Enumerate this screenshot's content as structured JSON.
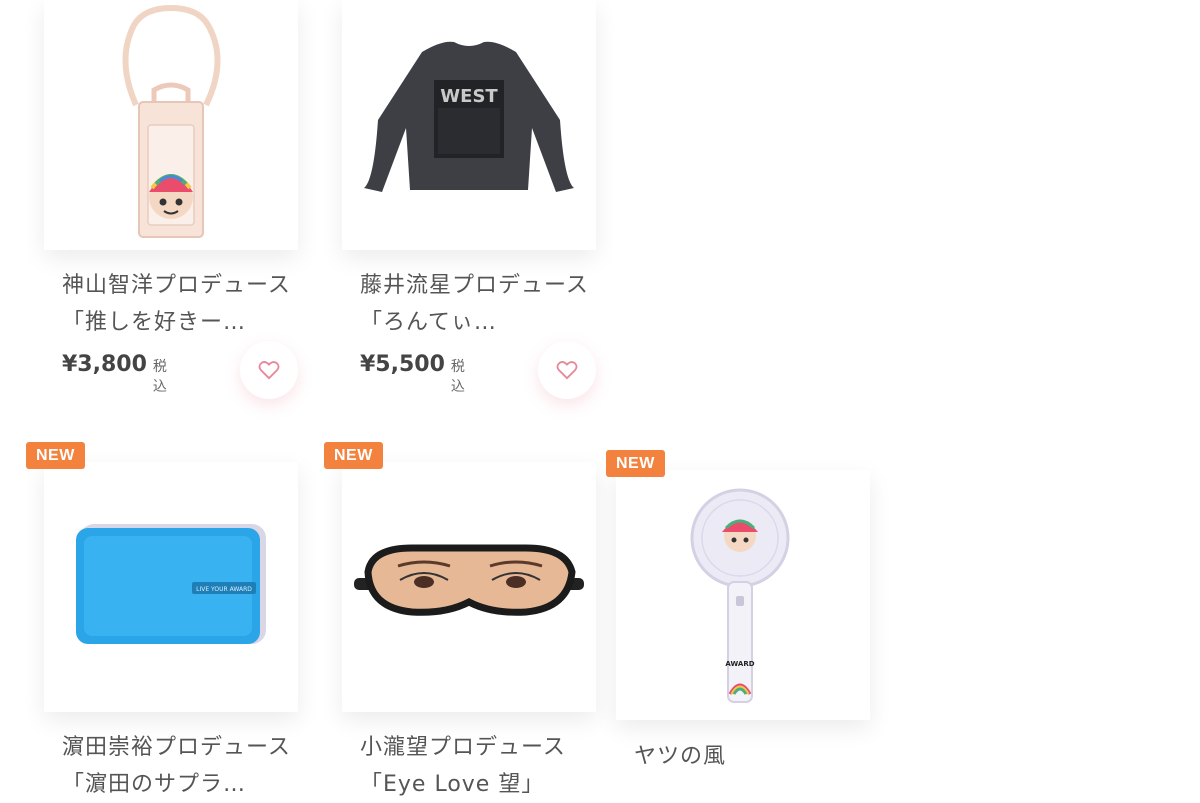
{
  "products": [
    {
      "title": "神山智洋プロデュース「推しを好きー…",
      "price": "¥3,800",
      "tax_label": "税込",
      "image_icon": "tote-bag-icon"
    },
    {
      "title": "藤井流星プロデュース「ろんてぃ…",
      "price": "¥5,500",
      "tax_label": "税込",
      "image_icon": "long-sleeve-shirt-icon",
      "shirt_print": "WEST"
    },
    {
      "badge": "NEW",
      "title": "濵田崇裕プロデュース「濵田のサプラ…",
      "image_icon": "blue-pouch-icon",
      "pouch_tag": "LIVE YOUR AWARD"
    },
    {
      "badge": "NEW",
      "title": "小瀧望プロデュース「Eye Love 望」",
      "image_icon": "eye-mask-icon"
    },
    {
      "badge": "NEW",
      "title": "ヤツの風",
      "image_icon": "handy-fan-icon",
      "fan_print": "AWARD"
    }
  ],
  "colors": {
    "badge": "#f3823e",
    "heart": "#e7889a",
    "pouch": "#2aa6e8"
  }
}
